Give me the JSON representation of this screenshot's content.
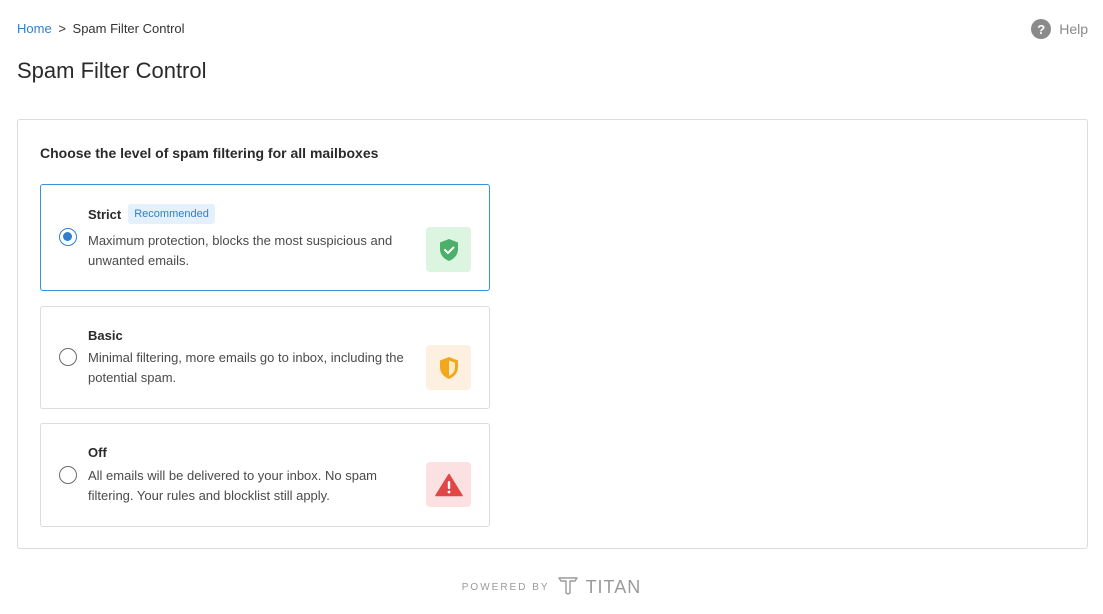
{
  "breadcrumb": {
    "home": "Home",
    "separator": ">",
    "current": "Spam Filter Control"
  },
  "help": {
    "icon": "question-circle-icon",
    "symbol": "?",
    "label": "Help"
  },
  "page": {
    "title": "Spam Filter Control"
  },
  "card": {
    "heading": "Choose the level of spam filtering for all mailboxes"
  },
  "options": [
    {
      "id": "strict",
      "title": "Strict",
      "badge": "Recommended",
      "selected": true,
      "description": "Maximum protection, blocks the most suspicious and unwanted emails.",
      "icon": "shield-check-icon",
      "color": "#4caf6a"
    },
    {
      "id": "basic",
      "title": "Basic",
      "selected": false,
      "description": "Minimal filtering, more emails go to inbox, including the potential spam.",
      "icon": "shield-half-icon",
      "color": "#f2a81d"
    },
    {
      "id": "off",
      "title": "Off",
      "selected": false,
      "description": "All emails will be delivered to your inbox. No spam filtering. Your rules and blocklist still apply.",
      "icon": "warning-triangle-icon",
      "color": "#e04848"
    }
  ],
  "footer": {
    "powered_by": "POWERED BY",
    "brand": "TITAN",
    "brand_icon": "titan-logo-icon"
  },
  "colors": {
    "accent": "#2f7fd1",
    "selected_border": "#3b8fd8"
  }
}
